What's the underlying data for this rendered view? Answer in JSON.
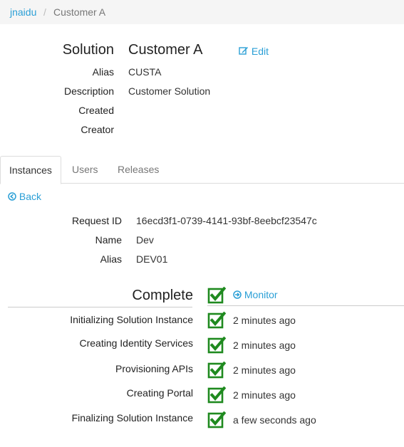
{
  "breadcrumb": {
    "root": "jnaidu",
    "separator": "/",
    "current": "Customer A"
  },
  "solution": {
    "heading_label": "Solution",
    "name": "Customer A",
    "edit_label": "Edit",
    "fields": [
      {
        "label": "Alias",
        "value": "CUSTA"
      },
      {
        "label": "Description",
        "value": "Customer Solution"
      },
      {
        "label": "Created",
        "value": ""
      },
      {
        "label": "Creator",
        "value": ""
      }
    ]
  },
  "tabs": [
    {
      "label": "Instances",
      "active": true
    },
    {
      "label": "Users",
      "active": false
    },
    {
      "label": "Releases",
      "active": false
    }
  ],
  "back_label": "Back",
  "instance": {
    "fields": [
      {
        "label": "Request ID",
        "value": "16ecd3f1-0739-4141-93bf-8eebcf23547c"
      },
      {
        "label": "Name",
        "value": "Dev"
      },
      {
        "label": "Alias",
        "value": "DEV01"
      }
    ],
    "status": "Complete",
    "monitor_label": "Monitor",
    "steps": [
      {
        "label": "Initializing Solution Instance",
        "time": "2 minutes ago"
      },
      {
        "label": "Creating Identity Services",
        "time": "2 minutes ago"
      },
      {
        "label": "Provisioning APIs",
        "time": "2 minutes ago"
      },
      {
        "label": "Creating Portal",
        "time": "2 minutes ago"
      },
      {
        "label": "Finalizing Solution Instance",
        "time": "a few seconds ago"
      }
    ]
  },
  "colors": {
    "link": "#2a9fd6",
    "check_green": "#1f8a1f",
    "breadcrumb_bg": "#f5f5f5"
  }
}
